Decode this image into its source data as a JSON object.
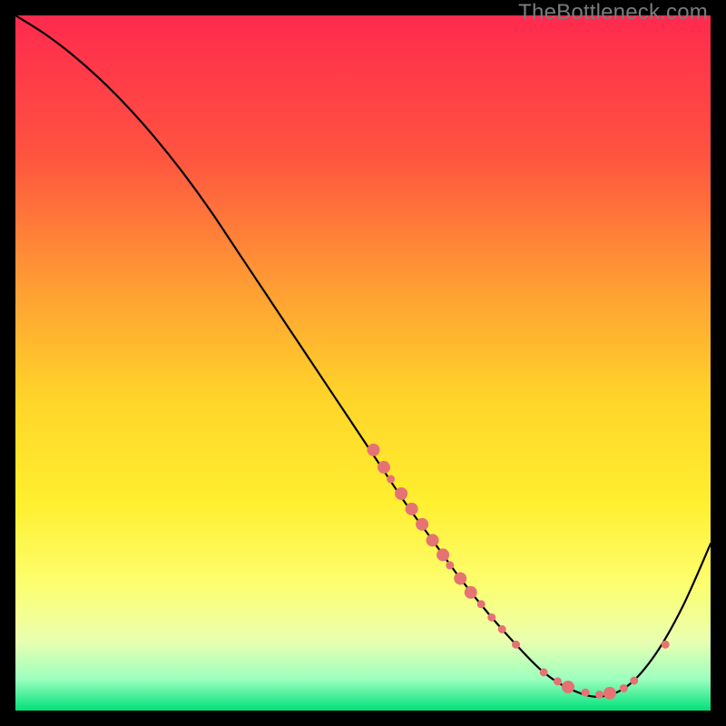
{
  "watermark": {
    "text": "TheBottleneck.com"
  },
  "chart_data": {
    "type": "line",
    "title": "",
    "xlabel": "",
    "ylabel": "",
    "xlim": [
      0,
      100
    ],
    "ylim": [
      0,
      100
    ],
    "grid": false,
    "legend": false,
    "background": {
      "style": "vertical-gradient",
      "stops": [
        {
          "pos": 0.0,
          "color": "#ff2a4e"
        },
        {
          "pos": 0.2,
          "color": "#ff5340"
        },
        {
          "pos": 0.4,
          "color": "#ffa133"
        },
        {
          "pos": 0.55,
          "color": "#ffd42a"
        },
        {
          "pos": 0.7,
          "color": "#ffef2f"
        },
        {
          "pos": 0.82,
          "color": "#fdff70"
        },
        {
          "pos": 0.9,
          "color": "#e9ffb0"
        },
        {
          "pos": 0.955,
          "color": "#9cffbf"
        },
        {
          "pos": 1.0,
          "color": "#00e07a"
        }
      ]
    },
    "series": [
      {
        "name": "bottleneck-curve",
        "color": "#000000",
        "width": 2.2,
        "x": [
          0,
          4,
          8,
          12,
          16,
          20,
          24,
          28,
          32,
          36,
          40,
          44,
          48,
          52,
          56,
          60,
          64,
          68,
          72,
          76,
          80,
          84,
          88,
          92,
          96,
          100
        ],
        "y": [
          100,
          97.5,
          94.5,
          91,
          87,
          82.5,
          77.5,
          72,
          66,
          60,
          54,
          48,
          42,
          36,
          30,
          24.5,
          19,
          14,
          9.5,
          5.5,
          3,
          2,
          3.5,
          8,
          15,
          24
        ]
      }
    ],
    "markers": {
      "style": "dot",
      "color": "#e57373",
      "radius_small": 4.5,
      "radius_large": 7,
      "points": [
        {
          "x": 51.5,
          "y": 37.5,
          "r": 7
        },
        {
          "x": 53.0,
          "y": 35.0,
          "r": 7
        },
        {
          "x": 54.0,
          "y": 33.3,
          "r": 4.5
        },
        {
          "x": 55.5,
          "y": 31.2,
          "r": 7
        },
        {
          "x": 57.0,
          "y": 29.0,
          "r": 7
        },
        {
          "x": 58.5,
          "y": 26.8,
          "r": 7
        },
        {
          "x": 60.0,
          "y": 24.5,
          "r": 7
        },
        {
          "x": 61.5,
          "y": 22.4,
          "r": 7
        },
        {
          "x": 62.5,
          "y": 20.9,
          "r": 4.5
        },
        {
          "x": 64.0,
          "y": 19.0,
          "r": 7
        },
        {
          "x": 65.5,
          "y": 17.0,
          "r": 7
        },
        {
          "x": 67.0,
          "y": 15.3,
          "r": 4.5
        },
        {
          "x": 68.5,
          "y": 13.4,
          "r": 4.5
        },
        {
          "x": 70.0,
          "y": 11.7,
          "r": 4.5
        },
        {
          "x": 72.0,
          "y": 9.5,
          "r": 4.5
        },
        {
          "x": 76.0,
          "y": 5.5,
          "r": 4.5
        },
        {
          "x": 78.0,
          "y": 4.2,
          "r": 4.5
        },
        {
          "x": 79.5,
          "y": 3.4,
          "r": 7
        },
        {
          "x": 82.0,
          "y": 2.6,
          "r": 4.5
        },
        {
          "x": 84.0,
          "y": 2.3,
          "r": 4.5
        },
        {
          "x": 85.5,
          "y": 2.5,
          "r": 7
        },
        {
          "x": 87.5,
          "y": 3.2,
          "r": 4.5
        },
        {
          "x": 89.0,
          "y": 4.3,
          "r": 4.5
        },
        {
          "x": 93.5,
          "y": 9.5,
          "r": 4.5
        }
      ]
    }
  }
}
